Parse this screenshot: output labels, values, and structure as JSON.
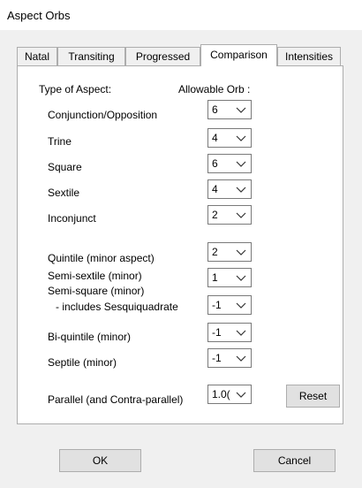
{
  "window": {
    "title": "Aspect Orbs"
  },
  "tabs": [
    {
      "label": "Natal"
    },
    {
      "label": "Transiting"
    },
    {
      "label": "Progressed"
    },
    {
      "label": "Comparison",
      "active": true
    },
    {
      "label": "Intensities"
    }
  ],
  "headers": {
    "type_of_aspect": "Type of Aspect:",
    "allowable_orb": "Allowable Orb :"
  },
  "aspects": [
    {
      "label": "Conjunction/Opposition",
      "orb": "6"
    },
    {
      "label": "Trine",
      "orb": "4"
    },
    {
      "label": "Square",
      "orb": "6"
    },
    {
      "label": "Sextile",
      "orb": "4"
    },
    {
      "label": "Inconjunct",
      "orb": "2"
    },
    {
      "label": "Quintile (minor aspect)",
      "orb": "2"
    },
    {
      "label": "Semi-sextile (minor)",
      "orb": "1"
    },
    {
      "label": "Semi-square (minor)",
      "label2": "- includes Sesquiquadrate",
      "orb": "-1"
    },
    {
      "label": "Bi-quintile (minor)",
      "orb": "-1"
    },
    {
      "label": "Septile (minor)",
      "orb": "-1"
    },
    {
      "label": "Parallel (and Contra-parallel)",
      "orb": "1.0("
    }
  ],
  "buttons": {
    "reset": "Reset",
    "ok": "OK",
    "cancel": "Cancel"
  }
}
